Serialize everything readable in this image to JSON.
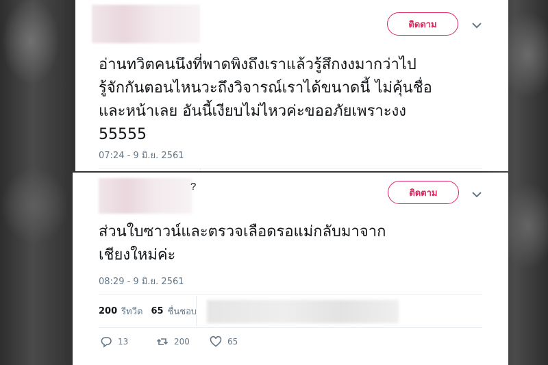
{
  "tweet1": {
    "follow_label": "ติดตาม",
    "text": "อ่านทวิตคนนึงที่พาดพิงถึงเราแล้วรู้สึกงงมากว่าไป\nรู้จักกันตอนไหนวะถึงวิจารณ์เราได้ขนาดนี้ ไม่คุ้นชื่อ\nและหน้าเลย อันนี้เงียบไม่ไหวค่ะขออภัยเพราะงง\n55555",
    "timestamp": "07:24 - 9 มิ.ย. 2561"
  },
  "tweet2": {
    "follow_label": "ติดตาม",
    "name_fragment": "?",
    "text": "ส่วนใบซาวน์และตรวจเลือดรอแม่กลับมาจาก\nเชียงใหม่ค่ะ",
    "timestamp": "08:29 - 9 มิ.ย. 2561",
    "retweets_count": "200",
    "retweets_label": "รีทวีต",
    "likes_count": "65",
    "likes_label": "ชื่นชอบ",
    "actions": {
      "reply_count": "13",
      "retweet_count": "200",
      "like_count": "65"
    }
  },
  "colors": {
    "accent": "#e0245e",
    "text": "#14171a",
    "muted": "#657786",
    "divider": "#e6ecf0"
  }
}
